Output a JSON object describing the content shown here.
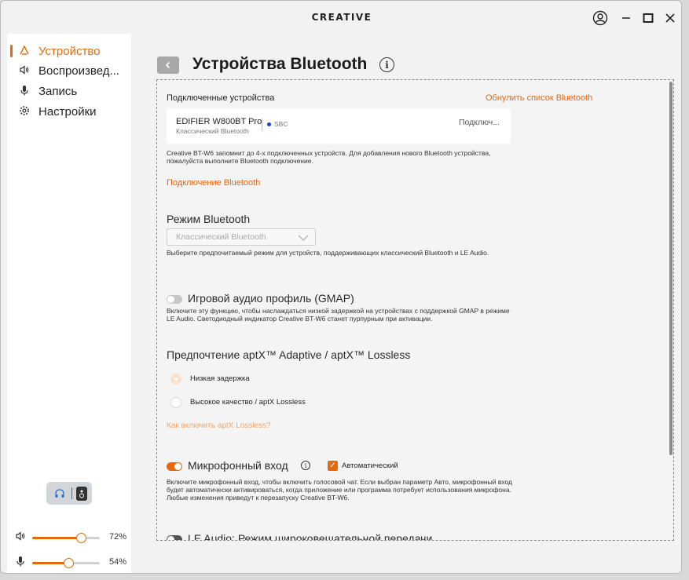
{
  "app": {
    "logo": "CREATIVE"
  },
  "window_controls": {
    "account_icon": "user-circle-icon",
    "minimize": "—",
    "maximize": "□",
    "close": "✕"
  },
  "sidebar": {
    "items": [
      {
        "label": "Устройство",
        "icon": "headphone-icon",
        "active": true
      },
      {
        "label": "Воспроизвед...",
        "icon": "speaker-icon",
        "active": false
      },
      {
        "label": "Запись",
        "icon": "microphone-icon",
        "active": false
      },
      {
        "label": "Настройки",
        "icon": "gear-icon",
        "active": false
      }
    ],
    "output": {
      "headphone": "headphone-icon",
      "speaker": "speaker-icon"
    },
    "playback_volume": {
      "percent": 72,
      "label": "72%"
    },
    "mic_volume": {
      "percent": 54,
      "label": "54%"
    }
  },
  "main": {
    "title": "Устройства Bluetooth",
    "connected": {
      "heading": "Подключенные устройства",
      "refresh_link": "Обнулить список Bluetooth",
      "device_name": "EDIFIER W800BT Pro",
      "device_type": "Классический Bluetooth",
      "codec": "SBC",
      "status": "Подключ...",
      "note": "Creative BT-W6 запомнит до 4-х подключенных устройств. Для добавления нового Bluetooth устройства, пожалуйста выполните Bluetooth подключение.",
      "connect_link": "Подключение Bluetooth"
    },
    "bt_mode": {
      "heading": "Режим Bluetooth",
      "selected": "Классический Bluetooth",
      "note": "Выберите предпочитаемый режим для устройств, поддерживающих классический Bluetooth и LE Audio."
    },
    "gmap": {
      "heading": "Игровой аудио профиль (GMAP)",
      "enabled": false,
      "note": "Включите эту функцию, чтобы наслаждаться низкой задержкой на устройствах с поддержкой GMAP в режиме LE Audio. Светодиодный индикатор Creative BT-W6 станет пурпурным при активации."
    },
    "aptx": {
      "heading": "Предпочтение aptX™ Adaptive / aptX™ Lossless",
      "options": [
        "Низкая задержка",
        "Высокое качество / aptX Lossless"
      ],
      "selected_index": 0,
      "help_link": "Как включить aptX Lossless?"
    },
    "mic": {
      "heading": "Микрофонный вход",
      "enabled": true,
      "auto_label": "Автоматический",
      "auto_checked": true,
      "note": "Включите микрофонный вход, чтобы включить голосовой чат. Если выбран параметр Авто, микрофонный вход будет автоматически активироваться, когда приложение или программа потребует использования микрофона. Любые изменения приведут к перезапуску Creative BT-W6."
    },
    "le_broadcast": {
      "heading": "LE Audio: Режим широковещательной передачи",
      "enabled": false
    }
  },
  "colors": {
    "accent": "#e46a0c",
    "link_light": "#f1a76a",
    "codec_dot": "#1a3fd6"
  }
}
